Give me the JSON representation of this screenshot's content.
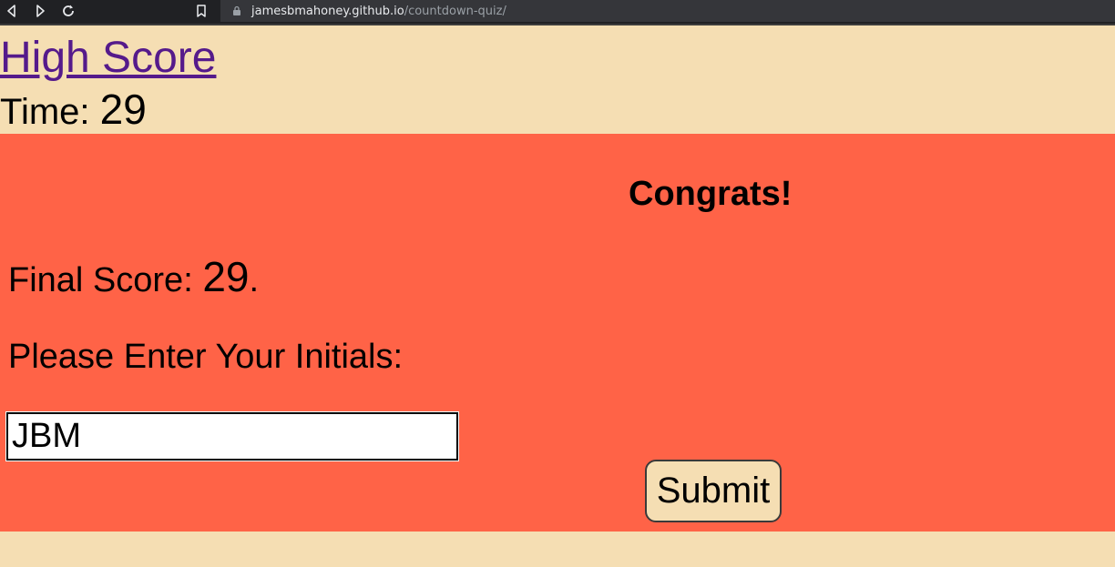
{
  "browser": {
    "url_host": "jamesbmahoney.github.io",
    "url_path": "/countdown-quiz/"
  },
  "header": {
    "high_score_link": "High Score",
    "time_label": "Time: ",
    "time_value": "29"
  },
  "result": {
    "heading": "Congrats!",
    "final_score_label": "Final Score: ",
    "final_score_value": "29",
    "final_score_suffix": ".",
    "initials_prompt": "Please Enter Your Initials:",
    "initials_value": "JBM",
    "submit_label": "Submit"
  },
  "colors": {
    "page_background": "#f5deb3",
    "panel_background": "#ff6347",
    "link": "#551a8b"
  }
}
